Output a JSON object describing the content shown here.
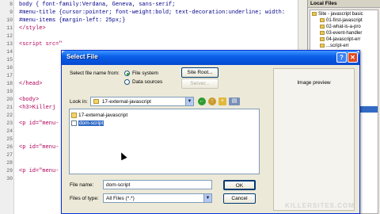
{
  "editor": {
    "gutter_numbers": [
      "8",
      "9",
      "10",
      "11",
      "12",
      "13",
      "14",
      "15",
      "16",
      "17",
      "18",
      "19",
      "20",
      "21",
      "22",
      "23",
      "24",
      "25",
      "26",
      "27",
      "28",
      "29",
      "30"
    ],
    "lines": [
      {
        "text": "body { font-family:Verdana, Geneva, sans-serif;",
        "style": "dark"
      },
      {
        "text": "#menu-title {cursor:pointer; font-weight:bold; text-decoration:underline; width:",
        "style": "dark"
      },
      {
        "text": "#menu-items {margin-left: 25px;}",
        "style": "dark"
      },
      {
        "text": "</style>",
        "style": "pink"
      },
      {
        "text": "",
        "style": "dark"
      },
      {
        "text": "<script src=\"",
        "style": "pink"
      },
      {
        "text": "",
        "style": "dark"
      },
      {
        "text": "",
        "style": "dark"
      },
      {
        "text": "",
        "style": "dark"
      },
      {
        "text": "",
        "style": "dark"
      },
      {
        "text": "</head>",
        "style": "pink"
      },
      {
        "text": "",
        "style": "dark"
      },
      {
        "text": "<body>",
        "style": "pink"
      },
      {
        "text": "<h3>Killerj",
        "style": "pink"
      },
      {
        "text": "",
        "style": "dark"
      },
      {
        "text": "<p id=\"menu-",
        "style": "pink"
      },
      {
        "text": "",
        "style": "dark"
      },
      {
        "text": "",
        "style": "dark"
      },
      {
        "text": "<p id=\"menu-",
        "style": "pink"
      },
      {
        "text": "",
        "style": "dark"
      },
      {
        "text": "",
        "style": "dark"
      },
      {
        "text": "<p id=\"menu-",
        "style": "pink"
      },
      {
        "text": "",
        "style": "dark"
      }
    ]
  },
  "files_panel": {
    "title": "Local Files",
    "items": [
      "Site - javascript basic",
      "01-first-javascript",
      "02-what-is-a-pro",
      "03-event-handler",
      "04-javascript-err",
      "...script-err",
      "...ents",
      "...ents",
      "...ents",
      "...s-part",
      "...",
      "...ion-pri",
      "...ter-dom",
      "...al-javas",
      "...ternal-ja",
      "...script.ht"
    ],
    "selected_index": 15
  },
  "dialog": {
    "title": "Select File",
    "help_glyph": "?",
    "close_glyph": "✕",
    "select_from_label": "Select file name from:",
    "radio_file_system": "File system",
    "radio_data_sources": "Data sources",
    "site_root_button": "Site Root...",
    "server_button": "Server...",
    "look_in_label": "Look in:",
    "look_in_value": "17-external-javascript",
    "files": [
      {
        "name": "17-external-javascript",
        "kind": "folder",
        "selected": false
      },
      {
        "name": "dom-script",
        "kind": "doc",
        "selected": true
      }
    ],
    "file_name_label": "File name:",
    "file_name_value": "dom-script",
    "files_of_type_label": "Files of type:",
    "files_of_type_value": "All Files (*.*)",
    "ok_button": "OK",
    "cancel_button": "Cancel",
    "preview_label": "Image preview"
  },
  "watermark": "KILLERSITES.COM"
}
